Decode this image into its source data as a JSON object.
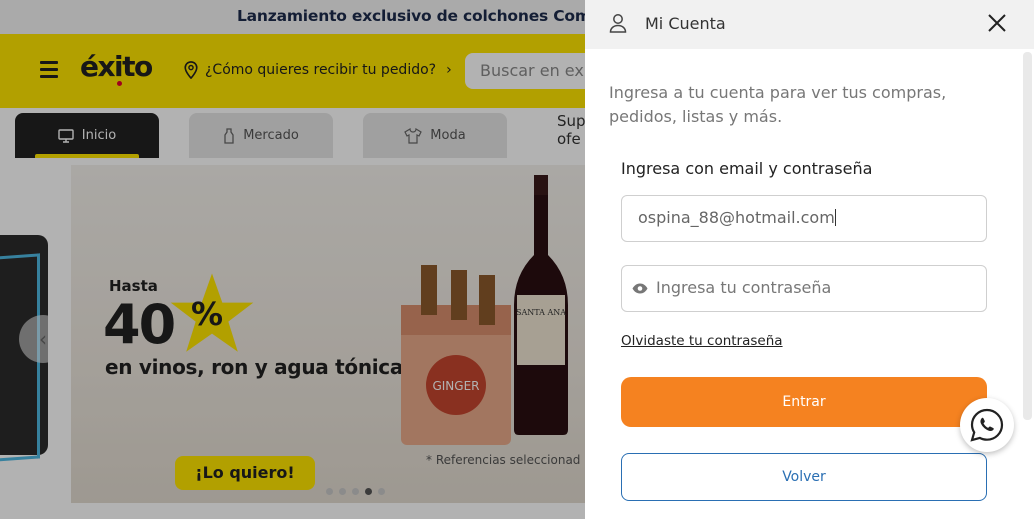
{
  "promo": {
    "text": "Lanzamiento exclusivo de colchones Come"
  },
  "header": {
    "logo": "éxito",
    "delivery_prompt": "¿Cómo quieres recibir tu pedido?",
    "search_placeholder": "Buscar en exito"
  },
  "nav": {
    "tabs": [
      {
        "label": "Inicio",
        "icon": "monitor-icon",
        "active": true
      },
      {
        "label": "Mercado",
        "icon": "bottle-icon",
        "active": false
      },
      {
        "label": "Moda",
        "icon": "shirt-icon",
        "active": false
      }
    ],
    "super_line1": "Sup",
    "super_line2": "ofe"
  },
  "banner": {
    "hasta": "Hasta",
    "discount": "40",
    "percent": "%",
    "subtitle": "en vinos, ron y agua tónica.",
    "cta": "¡Lo quiero!",
    "disclaimer": "* Referencias seleccionad",
    "dots_total": 5,
    "dots_active": 4
  },
  "drawer": {
    "title": "Mi Cuenta",
    "intro": "Ingresa a tu cuenta para ver tus compras, pedidos, listas y más.",
    "login_title": "Ingresa con email y contraseña",
    "email_value": "ospina_88@hotmail.com",
    "password_placeholder": "Ingresa tu contraseña",
    "forgot_link": "Olvidaste tu contraseña",
    "enter_button": "Entrar",
    "back_button": "Volver"
  },
  "colors": {
    "brand_yellow": "#ffe600",
    "accent_orange": "#f58220",
    "link_blue": "#2a6fb3"
  },
  "icons": {
    "menu": "hamburger-icon",
    "location": "location-pin-icon",
    "user": "user-icon",
    "close": "close-icon",
    "password": "eye-icon",
    "chat": "whatsapp-icon"
  }
}
